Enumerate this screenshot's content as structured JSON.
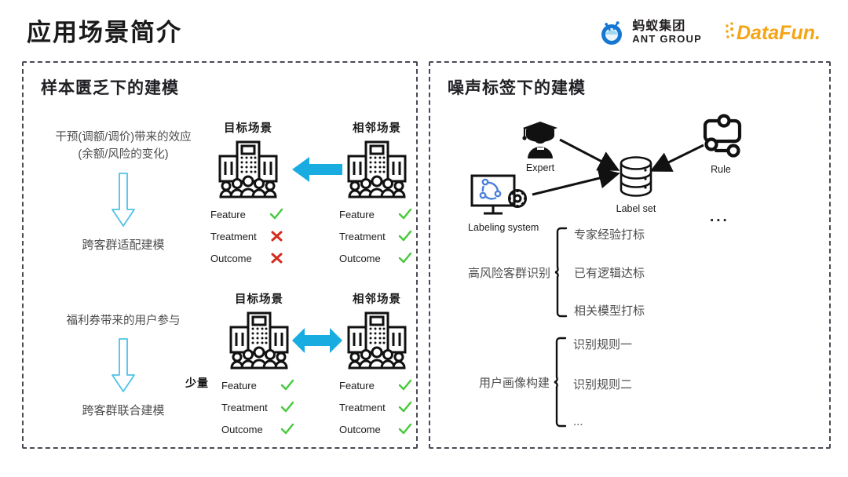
{
  "header": {
    "title": "应用场景简介",
    "logos": {
      "ant_cn": "蚂蚁集团",
      "ant_en": "ANT GROUP",
      "datafun": "DataFun.",
      "ant_color": "#1677d2",
      "datafun_color": "#f5a416"
    }
  },
  "colors": {
    "arrow_blue": "#19ace0",
    "check_green": "#45c93b",
    "cross_red": "#d42b1e",
    "panel_border": "#4a4a55",
    "body_text": "#4d4d4d"
  },
  "left_panel": {
    "title": "样本匮乏下的建模",
    "blocks": [
      {
        "cause_line1": "干预(调额/调价)带来的效应",
        "cause_line2": "(余额/风险的变化)",
        "arrow_icon": "down-arrow-outline",
        "effect": "跨客群适配建模",
        "arrow_between": "left-arrow",
        "quantity_badge": "",
        "scenarios": [
          {
            "label": "目标场景",
            "icon": "building-people-icon",
            "attrs": [
              {
                "name": "Feature",
                "mark": "check"
              },
              {
                "name": "Treatment",
                "mark": "cross"
              },
              {
                "name": "Outcome",
                "mark": "cross"
              }
            ]
          },
          {
            "label": "相邻场景",
            "icon": "building-people-icon",
            "attrs": [
              {
                "name": "Feature",
                "mark": "check"
              },
              {
                "name": "Treatment",
                "mark": "check"
              },
              {
                "name": "Outcome",
                "mark": "check"
              }
            ]
          }
        ]
      },
      {
        "cause_line1": "福利券带来的用户参与",
        "cause_line2": "",
        "arrow_icon": "down-arrow-outline",
        "effect": "跨客群联合建模",
        "arrow_between": "double-arrow",
        "quantity_badge": "少量",
        "scenarios": [
          {
            "label": "目标场景",
            "icon": "building-people-icon",
            "attrs": [
              {
                "name": "Feature",
                "mark": "check"
              },
              {
                "name": "Treatment",
                "mark": "check"
              },
              {
                "name": "Outcome",
                "mark": "check"
              }
            ]
          },
          {
            "label": "相邻场景",
            "icon": "building-people-icon",
            "attrs": [
              {
                "name": "Feature",
                "mark": "check"
              },
              {
                "name": "Treatment",
                "mark": "check"
              },
              {
                "name": "Outcome",
                "mark": "check"
              }
            ]
          }
        ]
      }
    ]
  },
  "right_panel": {
    "title": "噪声标签下的建模",
    "sources": [
      {
        "id": "expert",
        "caption": "Expert",
        "icon": "graduate-expert-icon"
      },
      {
        "id": "labeling-system",
        "caption": "Labeling system",
        "icon": "monitor-gear-icon"
      },
      {
        "id": "label-set",
        "caption": "Label set",
        "icon": "database-icon"
      },
      {
        "id": "rule",
        "caption": "Rule",
        "icon": "rule-node-icon"
      }
    ],
    "ellipsis": "...",
    "brace_lists": [
      {
        "label": "高风险客群识别",
        "items": [
          "专家经验打标",
          "已有逻辑达标",
          "相关模型打标"
        ]
      },
      {
        "label": "用户画像构建",
        "items": [
          "识别规则一",
          "识别规则二",
          "..."
        ]
      }
    ]
  }
}
